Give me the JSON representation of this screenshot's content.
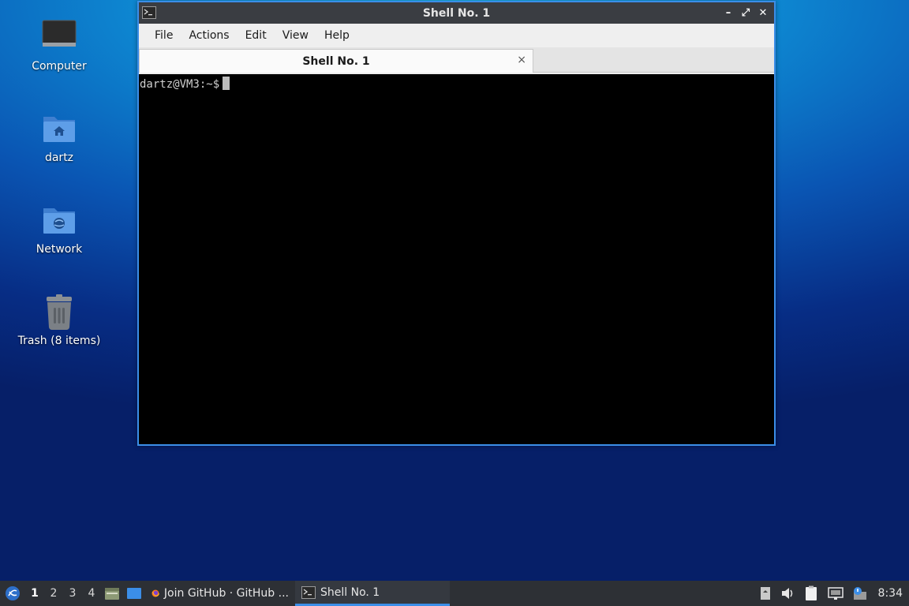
{
  "desktop": {
    "icons": [
      {
        "label": "Computer"
      },
      {
        "label": "dartz"
      },
      {
        "label": "Network"
      },
      {
        "label": "Trash (8 items)"
      }
    ]
  },
  "window": {
    "title": "Shell No. 1",
    "menu": [
      "File",
      "Actions",
      "Edit",
      "View",
      "Help"
    ],
    "tab": {
      "label": "Shell No. 1",
      "close": "×"
    },
    "terminal": {
      "prompt": "dartz@VM3:~$"
    },
    "controls": {
      "minimize": "–",
      "maximize": "⤢",
      "close": "✕"
    }
  },
  "taskbar": {
    "workspaces": [
      "1",
      "2",
      "3",
      "4"
    ],
    "active_workspace": "1",
    "tasks": [
      {
        "label": "Join GitHub · GitHub ...",
        "icon": "firefox-icon"
      },
      {
        "label": "Shell No. 1",
        "icon": "terminal-icon"
      }
    ],
    "clock": "8:34"
  },
  "colors": {
    "accent": "#3b8ee8",
    "titlebar": "#3a3d42",
    "taskbar": "#2d3035"
  }
}
